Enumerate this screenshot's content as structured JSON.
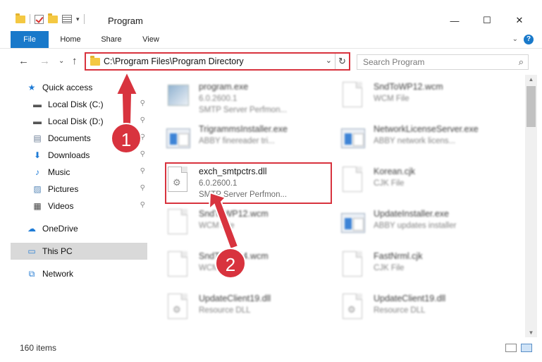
{
  "window": {
    "title": "Program",
    "minimize": "—",
    "maximize": "☐",
    "close": "✕"
  },
  "ribbon": {
    "tabs": [
      "File",
      "Home",
      "Share",
      "View"
    ],
    "expand": "⌄",
    "help": "?"
  },
  "address": {
    "path": "C:\\Program Files\\Program Directory",
    "dropdown": "⌄",
    "refresh": "↻",
    "back": "←",
    "forward": "→",
    "recent": "⌄",
    "up": "↑"
  },
  "search": {
    "placeholder": "Search Program",
    "icon": "⌕"
  },
  "sidebar": {
    "items": [
      {
        "label": "Quick access",
        "icon": "★",
        "icon_color": "#1e7bd6",
        "pinned": false
      },
      {
        "label": "Local Disk (C:)",
        "icon": "▬",
        "icon_color": "#555555",
        "pinned": true
      },
      {
        "label": "Local Disk (D:)",
        "icon": "▬",
        "icon_color": "#555555",
        "pinned": true
      },
      {
        "label": "Documents",
        "icon": "▤",
        "icon_color": "#6b7d96",
        "pinned": true
      },
      {
        "label": "Downloads",
        "icon": "⬇",
        "icon_color": "#1e7bd6",
        "pinned": true
      },
      {
        "label": "Music",
        "icon": "♪",
        "icon_color": "#1e7bd6",
        "pinned": true
      },
      {
        "label": "Pictures",
        "icon": "▨",
        "icon_color": "#5a89b8",
        "pinned": true
      },
      {
        "label": "Videos",
        "icon": "▦",
        "icon_color": "#444444",
        "pinned": true
      },
      {
        "label": "OneDrive",
        "icon": "☁",
        "icon_color": "#1e7bd6",
        "pinned": false
      },
      {
        "label": "This PC",
        "icon": "▭",
        "icon_color": "#2a7fd4",
        "pinned": false
      },
      {
        "label": "Network",
        "icon": "⧉",
        "icon_color": "#2a7fd4",
        "pinned": false
      }
    ],
    "pin_icon": "⚲"
  },
  "files": [
    {
      "name": "program.exe",
      "line2": "6.0.2600.1",
      "line3": "SMTP Server Perfmon...",
      "icon": "exe"
    },
    {
      "name": "SndToWP12.wcm",
      "line2": "WCM File",
      "line3": "",
      "icon": "doc"
    },
    {
      "name": "TrigrammsInstaller.exe",
      "line2": "ABBY finereader tri...",
      "line3": "",
      "icon": "app"
    },
    {
      "name": "NetworkLicenseServer.exe",
      "line2": "ABBY network licens...",
      "line3": "",
      "icon": "app"
    },
    {
      "name": "exch_smtpctrs.dll",
      "line2": "6.0.2600.1",
      "line3": "SMTP Server Perfmon...",
      "icon": "dll"
    },
    {
      "name": "Korean.cjk",
      "line2": "CJK File",
      "line3": "",
      "icon": "doc"
    },
    {
      "name": "SndToWP12.wcm",
      "line2": "WCM File",
      "line3": "",
      "icon": "doc"
    },
    {
      "name": "UpdateInstaller.exe",
      "line2": "ABBY updates installer",
      "line3": "",
      "icon": "app"
    },
    {
      "name": "SndToWP14.wcm",
      "line2": "WCM File",
      "line3": "",
      "icon": "doc"
    },
    {
      "name": "FastNrml.cjk",
      "line2": "CJK File",
      "line3": "",
      "icon": "doc"
    },
    {
      "name": "UpdateClient19.dll",
      "line2": "Resource DLL",
      "line3": "",
      "icon": "dll"
    },
    {
      "name": "UpdateClient19.dll",
      "line2": "Resource DLL",
      "line3": "",
      "icon": "dll"
    }
  ],
  "status": {
    "count": "160 items"
  },
  "annotations": {
    "badge1": "1",
    "badge2": "2",
    "color": "#d8333e"
  }
}
